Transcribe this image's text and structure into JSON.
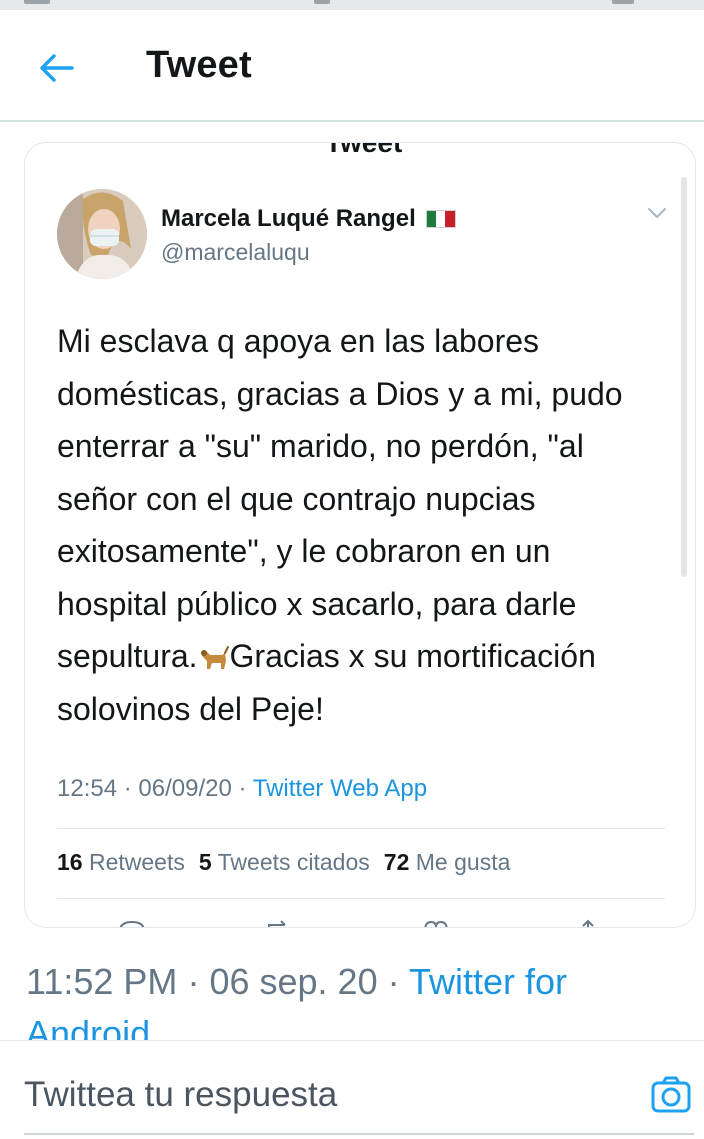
{
  "header": {
    "title": "Tweet"
  },
  "embedded": {
    "peek_title": "Tweet",
    "author": {
      "name": "Marcela Luqué Rangel",
      "handle": "@marcelaluqu",
      "flag": "mexico-flag"
    },
    "text_before_emoji": "Mi esclava q apoya en las labores domésticas, gracias a Dios y a mi, pudo enterrar a \"su\" marido, no perdón, \"al señor con el que contrajo nupcias exitosamente\", y le cobraron en un hospital público x sacarlo, para darle sepultura.",
    "emoji": "dog-emoji",
    "text_after_emoji": "Gracias x su mortificación solovinos del Peje!",
    "meta": {
      "time": "12:54",
      "separator1": "·",
      "date": "06/09/20",
      "separator2": "·",
      "app": "Twitter Web App"
    },
    "stats": {
      "retweets_count": "16",
      "retweets_label": "Retweets",
      "quotes_count": "5",
      "quotes_label": "Tweets citados",
      "likes_count": "72",
      "likes_label": "Me gusta"
    }
  },
  "outer_meta": {
    "time": "11:52 PM",
    "separator1": "·",
    "date": "06 sep. 20",
    "separator2": "·",
    "app": "Twitter for Android"
  },
  "reply": {
    "placeholder": "Twittea tu respuesta"
  },
  "colors": {
    "link_blue": "#1b95e0",
    "text_primary": "#14171a",
    "text_secondary": "#657786",
    "border": "#e1e8ed"
  }
}
